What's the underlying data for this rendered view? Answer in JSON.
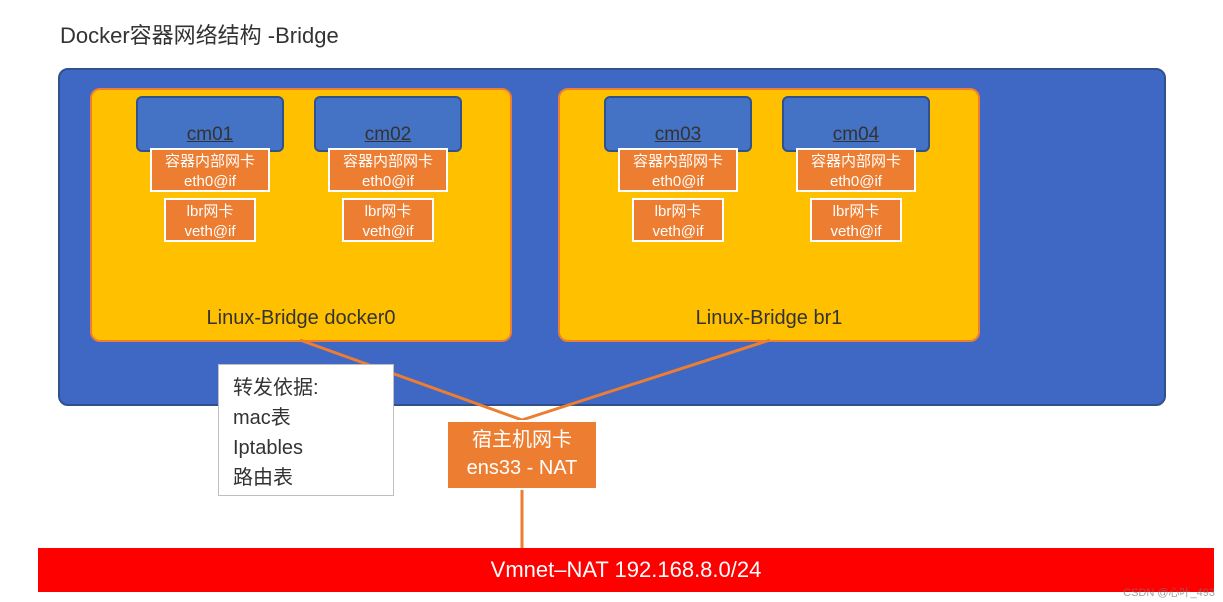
{
  "title": "Docker容器网络结构 -Bridge",
  "bridges": [
    {
      "label": "Linux-Bridge docker0",
      "containers": [
        {
          "name": "cm01",
          "nic_inner_l1": "容器内部网卡",
          "nic_inner_l2": "eth0@if",
          "lbr_l1": "lbr网卡",
          "lbr_l2": "veth@if"
        },
        {
          "name": "cm02",
          "nic_inner_l1": "容器内部网卡",
          "nic_inner_l2": "eth0@if",
          "lbr_l1": "lbr网卡",
          "lbr_l2": "veth@if"
        }
      ]
    },
    {
      "label": "Linux-Bridge br1",
      "containers": [
        {
          "name": "cm03",
          "nic_inner_l1": "容器内部网卡",
          "nic_inner_l2": "eth0@if",
          "lbr_l1": "lbr网卡",
          "lbr_l2": "veth@if"
        },
        {
          "name": "cm04",
          "nic_inner_l1": "容器内部网卡",
          "nic_inner_l2": "eth0@if",
          "lbr_l1": "lbr网卡",
          "lbr_l2": "veth@if"
        }
      ]
    }
  ],
  "forward": {
    "title": "转发依据:",
    "line1": "mac表",
    "line2": "Iptables",
    "line3": "路由表"
  },
  "host_nic": {
    "line1": "宿主机网卡",
    "line2": "ens33 - NAT"
  },
  "vmnet": "Vmnet–NAT  192.168.8.0/24",
  "watermark": "CSDN @心叶_493"
}
